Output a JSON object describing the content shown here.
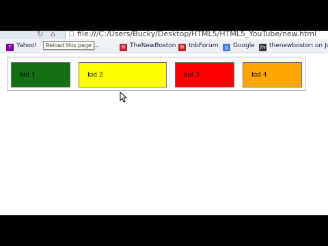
{
  "browser": {
    "url": "file:///C:/Users/Bucky/Desktop/HTML5/HTML5_YouTube/new.html",
    "tooltip": "Reload this page"
  },
  "bookmarks": [
    {
      "label": "Yahoo!",
      "icon": "yahoo-icon",
      "color": "#7b0099"
    },
    {
      "label": "thenewb...",
      "icon": "page-icon",
      "color": "#5c8ad6"
    },
    {
      "label": "TheNewBoston",
      "icon": "tnb-icon",
      "color": "#c0282d"
    },
    {
      "label": "tnbForum",
      "icon": "tnb-icon",
      "color": "#c0282d"
    },
    {
      "label": "Google",
      "icon": "google-icon",
      "color": "#4a7be0"
    },
    {
      "label": "thenewboston on Ju...",
      "icon": "justin-icon",
      "color": "#333333"
    }
  ],
  "kids": [
    {
      "label": "kid 1",
      "color": "#157015"
    },
    {
      "label": "kid 2",
      "color": "#ffff00"
    },
    {
      "label": "kid 3",
      "color": "#ff0000"
    },
    {
      "label": "kid 4",
      "color": "#ffa500"
    }
  ]
}
